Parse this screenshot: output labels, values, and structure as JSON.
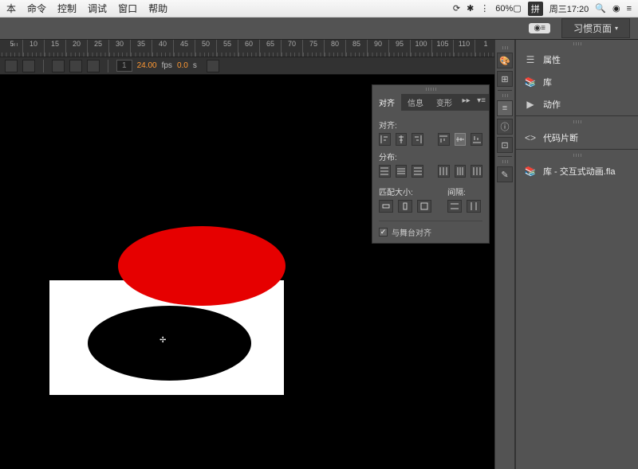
{
  "macmenu": {
    "items": [
      "本",
      "命令",
      "控制",
      "调试",
      "窗口",
      "帮助"
    ],
    "battery": "60%",
    "ime": "拼",
    "clock": "周三17:20"
  },
  "apptop": {
    "workspace": "习惯页面"
  },
  "ruler": {
    "ticks": [
      "5",
      "10",
      "15",
      "20",
      "25",
      "30",
      "35",
      "40",
      "45",
      "50",
      "55",
      "60",
      "65",
      "70",
      "75",
      "80",
      "85",
      "90",
      "95",
      "100",
      "105",
      "110",
      "1"
    ]
  },
  "timeline_bar": {
    "frame": "1",
    "fps": "24.00",
    "fps_unit": "fps",
    "time": "0.0",
    "time_unit": "s"
  },
  "align_panel": {
    "tabs": [
      "对齐",
      "信息",
      "变形"
    ],
    "section_align": "对齐:",
    "section_distribute": "分布:",
    "section_match": "匹配大小:",
    "section_spacing": "间隔:",
    "align_to_stage": "与舞台对齐"
  },
  "right_panel": {
    "properties": "属性",
    "library": "库",
    "actions": "动作",
    "code_snippets": "代码片断",
    "library_file": "库 - 交互式动画.fla"
  }
}
